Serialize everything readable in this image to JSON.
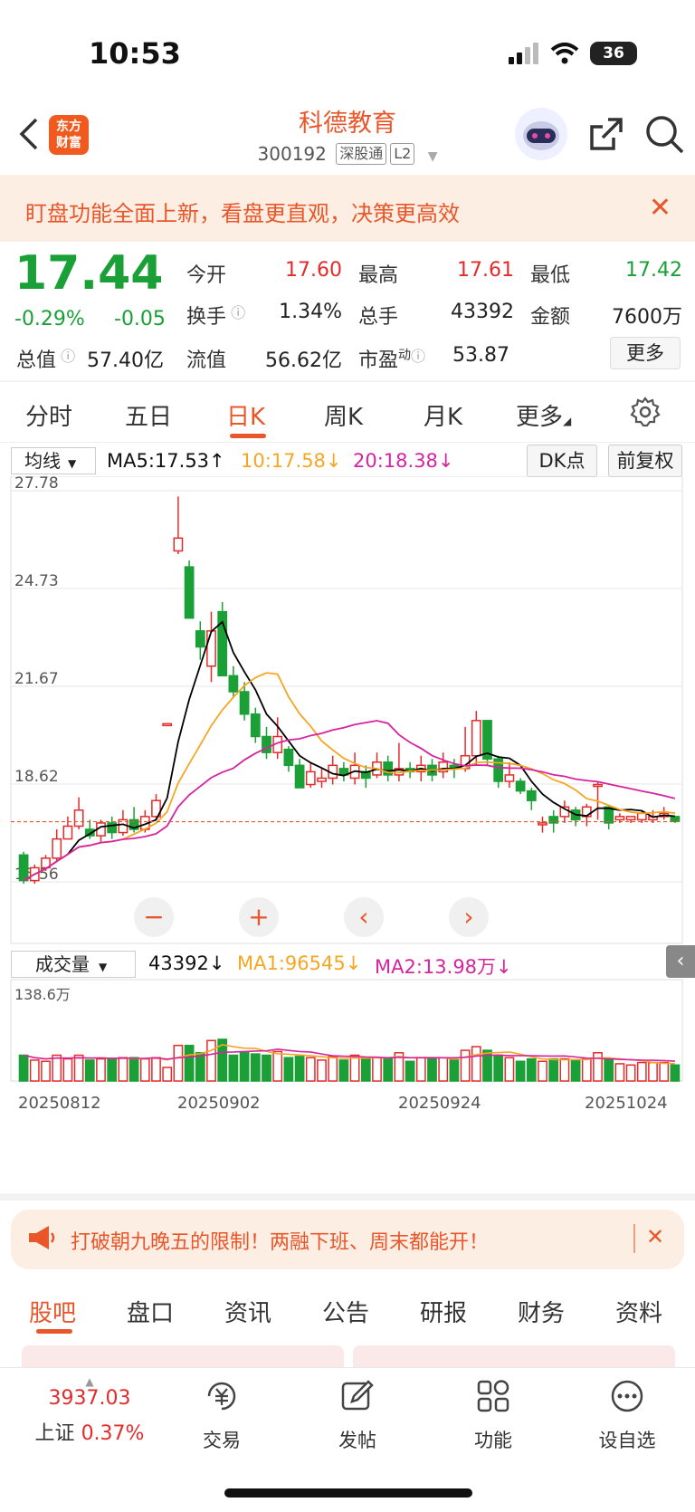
{
  "status": {
    "time": "10:53",
    "battery": "36"
  },
  "header": {
    "logo_line1": "东方",
    "logo_line2": "财富",
    "title": "科德教育",
    "code": "300192",
    "tag1": "深股通",
    "tag2": "L2"
  },
  "banner": {
    "text": "盯盘功能全面上新，看盘更直观，决策更高效",
    "close": "✕"
  },
  "quote": {
    "price": "17.44",
    "change_pct": "-0.29%",
    "change": "-0.05",
    "open_label": "今开",
    "open": "17.60",
    "high_label": "最高",
    "high": "17.61",
    "low_label": "最低",
    "low": "17.42",
    "turnover_label": "换手",
    "turnover": "1.34%",
    "volume_label": "总手",
    "volume": "43392",
    "amount_label": "金额",
    "amount": "7600万",
    "mktcap_label": "总值",
    "mktcap": "57.40亿",
    "float_label": "流值",
    "float": "56.62亿",
    "pe_label": "市盈",
    "pe_sup": "动",
    "pe": "53.87",
    "more": "更多"
  },
  "period_tabs": [
    "分时",
    "五日",
    "日K",
    "周K",
    "月K",
    "更多"
  ],
  "indicator": {
    "selector": "均线",
    "ma5": "MA5:17.53",
    "ma10": "10:17.58",
    "ma20": "20:18.38",
    "dk": "DK点",
    "fq": "前复权"
  },
  "volume_bar": {
    "selector": "成交量",
    "vol": "43392",
    "ma1": "MA1:96545",
    "ma2": "MA2:13.98万",
    "max_label": "138.6万"
  },
  "colors": {
    "accent": "#e8562a",
    "up": "#e32b2b",
    "down": "#1aa037",
    "ma5": "#000000",
    "ma10": "#f5a623",
    "ma20": "#d6249f"
  },
  "chart_data": {
    "type": "candlestick",
    "y_ticks": [
      "27.78",
      "24.73",
      "21.67",
      "18.62",
      "15.56"
    ],
    "ylim": [
      15.56,
      27.78
    ],
    "x_ticks": [
      "20250812",
      "20250902",
      "20250924",
      "20251024"
    ],
    "candles": [
      [
        16.4,
        15.6,
        16.5,
        15.5
      ],
      [
        15.6,
        16.0,
        16.1,
        15.5
      ],
      [
        16.0,
        16.3,
        16.4,
        15.9
      ],
      [
        16.3,
        16.9,
        17.2,
        16.2
      ],
      [
        16.9,
        17.3,
        17.6,
        16.9
      ],
      [
        17.3,
        17.8,
        18.2,
        17.2
      ],
      [
        17.2,
        17.0,
        17.5,
        16.9
      ],
      [
        17.0,
        17.4,
        17.5,
        16.8
      ],
      [
        17.4,
        17.1,
        17.6,
        16.9
      ],
      [
        17.1,
        17.5,
        17.8,
        17.0
      ],
      [
        17.5,
        17.2,
        17.9,
        17.1
      ],
      [
        17.2,
        17.6,
        17.8,
        17.1
      ],
      [
        17.6,
        18.1,
        18.3,
        17.5
      ],
      [
        20.5,
        20.5,
        20.5,
        20.5
      ],
      [
        25.9,
        26.3,
        27.6,
        25.8
      ],
      [
        25.4,
        23.8,
        25.6,
        23.8
      ],
      [
        23.4,
        22.9,
        23.7,
        22.5
      ],
      [
        22.3,
        23.4,
        24.0,
        21.8
      ],
      [
        24.0,
        22.0,
        24.3,
        22.0
      ],
      [
        22.0,
        21.5,
        22.3,
        21.3
      ],
      [
        21.5,
        20.8,
        21.8,
        20.6
      ],
      [
        20.8,
        20.1,
        21.0,
        19.9
      ],
      [
        20.1,
        19.6,
        20.4,
        19.4
      ],
      [
        19.6,
        20.1,
        20.7,
        19.4
      ],
      [
        19.7,
        19.2,
        19.8,
        19.0
      ],
      [
        19.2,
        18.5,
        19.4,
        18.5
      ],
      [
        18.6,
        19.0,
        19.3,
        18.5
      ],
      [
        18.7,
        18.8,
        19.1,
        18.5
      ],
      [
        18.8,
        19.2,
        19.5,
        18.6
      ],
      [
        19.1,
        18.9,
        19.3,
        18.7
      ],
      [
        18.8,
        19.2,
        19.6,
        18.6
      ],
      [
        19.0,
        18.8,
        19.2,
        18.5
      ],
      [
        18.9,
        19.3,
        19.6,
        18.8
      ],
      [
        19.3,
        18.9,
        19.5,
        18.7
      ],
      [
        18.9,
        19.1,
        19.9,
        18.7
      ],
      [
        19.1,
        19.0,
        19.3,
        18.8
      ],
      [
        19.0,
        19.2,
        19.5,
        18.7
      ],
      [
        19.2,
        18.9,
        19.4,
        18.7
      ],
      [
        19.0,
        19.3,
        19.6,
        18.8
      ],
      [
        19.2,
        19.1,
        19.4,
        18.8
      ],
      [
        19.1,
        19.5,
        20.4,
        19.0
      ],
      [
        19.5,
        20.6,
        20.9,
        19.2
      ],
      [
        20.6,
        19.4,
        20.6,
        19.2
      ],
      [
        19.4,
        18.7,
        19.5,
        18.5
      ],
      [
        18.7,
        18.9,
        19.3,
        18.5
      ],
      [
        18.7,
        18.4,
        18.8,
        18.3
      ],
      [
        18.4,
        18.1,
        18.5,
        17.8
      ],
      [
        17.4,
        17.4,
        17.6,
        17.1
      ],
      [
        17.6,
        17.4,
        17.8,
        17.1
      ],
      [
        17.6,
        17.9,
        18.1,
        17.4
      ],
      [
        17.8,
        17.5,
        17.9,
        17.3
      ],
      [
        17.6,
        17.9,
        18.0,
        17.3
      ],
      [
        18.6,
        18.6,
        18.7,
        17.5
      ],
      [
        17.9,
        17.4,
        17.9,
        17.2
      ],
      [
        17.5,
        17.6,
        17.7,
        17.4
      ],
      [
        17.5,
        17.6,
        17.6,
        17.4
      ],
      [
        17.5,
        17.7,
        17.8,
        17.4
      ],
      [
        17.5,
        17.6,
        17.8,
        17.4
      ],
      [
        17.6,
        17.7,
        17.9,
        17.5
      ],
      [
        17.6,
        17.45,
        17.6,
        17.4
      ]
    ],
    "volume": {
      "ylim": [
        0,
        1386000
      ]
    }
  },
  "controls": {
    "minus": "−",
    "plus": "+",
    "prev": "‹",
    "next": "›"
  },
  "promo": {
    "text": "打破朝九晚五的限制！两融下班、周末都能开！",
    "close": "✕"
  },
  "bottom_tabs": [
    "股吧",
    "盘口",
    "资讯",
    "公告",
    "研报",
    "财务",
    "资料"
  ],
  "nav": {
    "index_value": "3937.03",
    "index_name": "上证",
    "index_pct": "0.37%",
    "trade": "交易",
    "post": "发帖",
    "func": "功能",
    "watch": "设自选"
  }
}
